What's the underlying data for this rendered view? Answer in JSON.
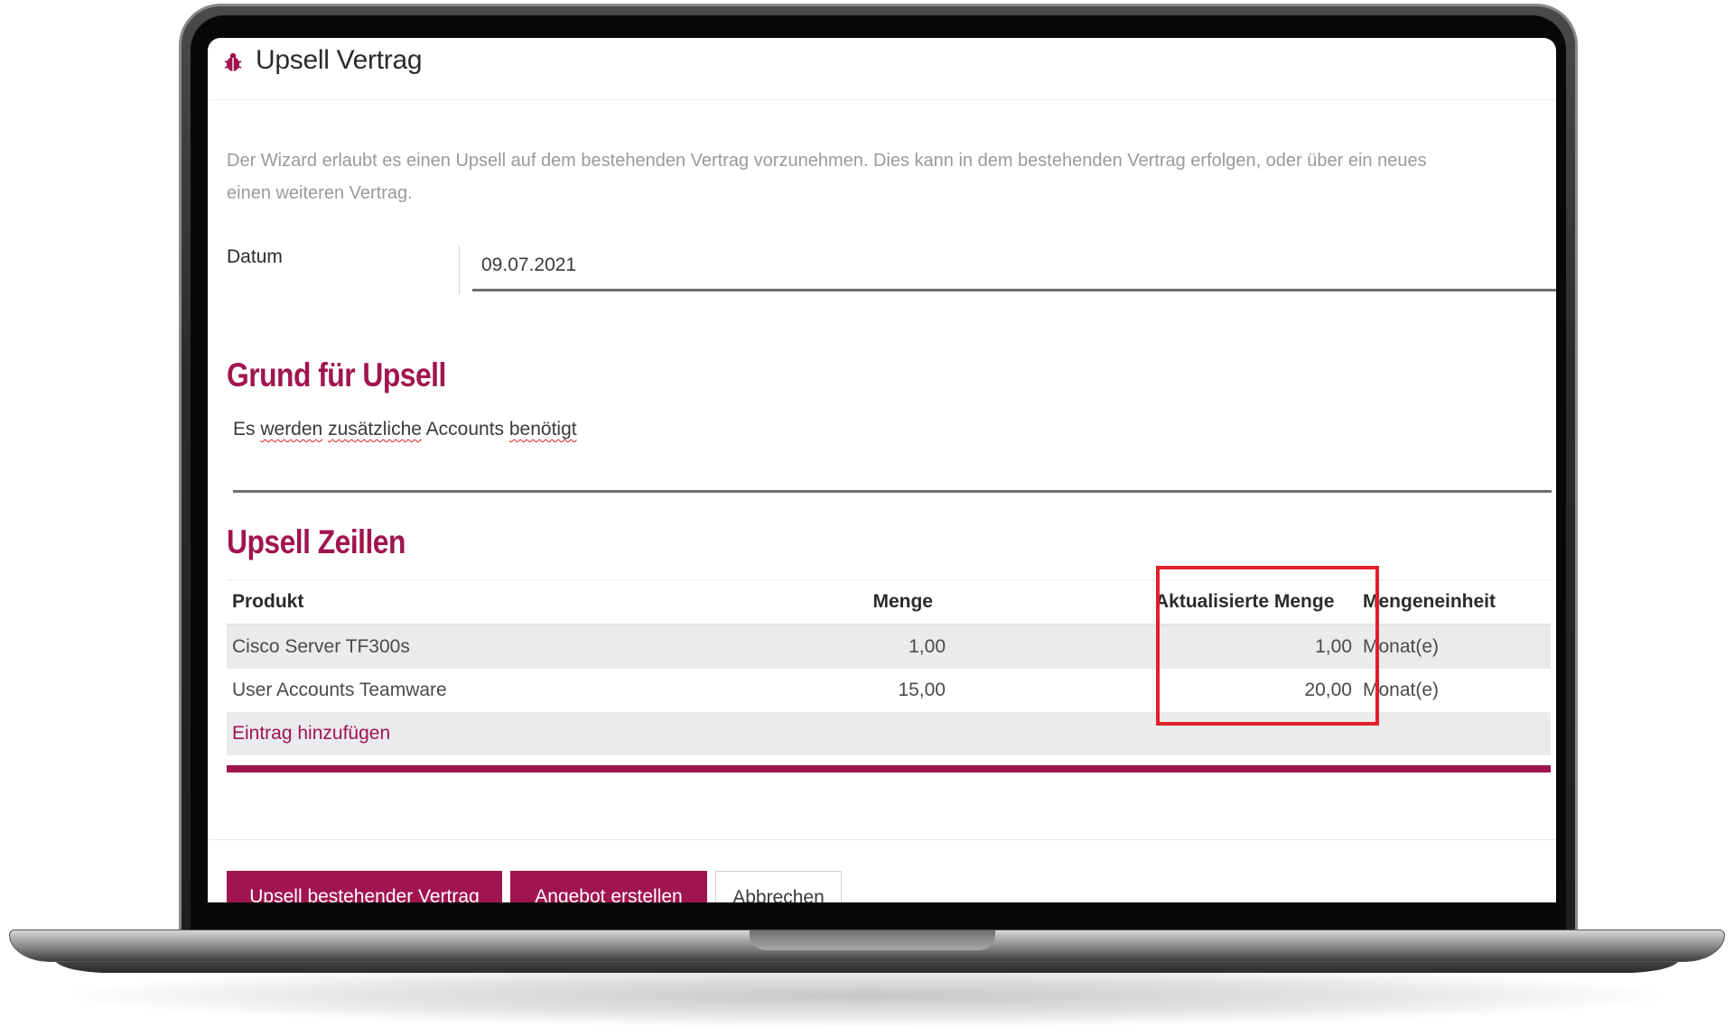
{
  "window": {
    "title": "Upsell Vertrag",
    "icon": "ladybug-icon",
    "accent_color": "#a0144f"
  },
  "intro": {
    "line1": "Der Wizard erlaubt es einen Upsell auf dem bestehenden Vertrag vorzunehmen. Dies kann in dem bestehenden Vertrag erfolgen, oder über ein neues",
    "line2": "einen weiteren Vertrag."
  },
  "datum": {
    "label": "Datum",
    "value": "09.07.2021"
  },
  "grund": {
    "heading": "Grund für Upsell",
    "text_parts": [
      "Es ",
      "werden",
      " ",
      "zusätzliche",
      " Accounts ",
      "benötigt"
    ]
  },
  "upsell_lines": {
    "heading": "Upsell Zeillen",
    "columns": {
      "product": "Produkt",
      "quantity": "Menge",
      "updated_quantity": "Aktualisierte Menge",
      "unit": "Mengeneinheit"
    },
    "rows": [
      {
        "product": "Cisco Server TF300s",
        "quantity": "1,00",
        "updated_quantity": "1,00",
        "unit": "Monat(e)"
      },
      {
        "product": "User Accounts Teamware",
        "quantity": "15,00",
        "updated_quantity": "20,00",
        "unit": "Monat(e)"
      }
    ],
    "add_entry": "Eintrag hinzufügen",
    "highlight_color": "#e0202a"
  },
  "buttons": {
    "upsell_existing": "Upsell bestehender Vertrag",
    "create_offer": "Angebot erstellen",
    "cancel": "Abbrechen"
  }
}
